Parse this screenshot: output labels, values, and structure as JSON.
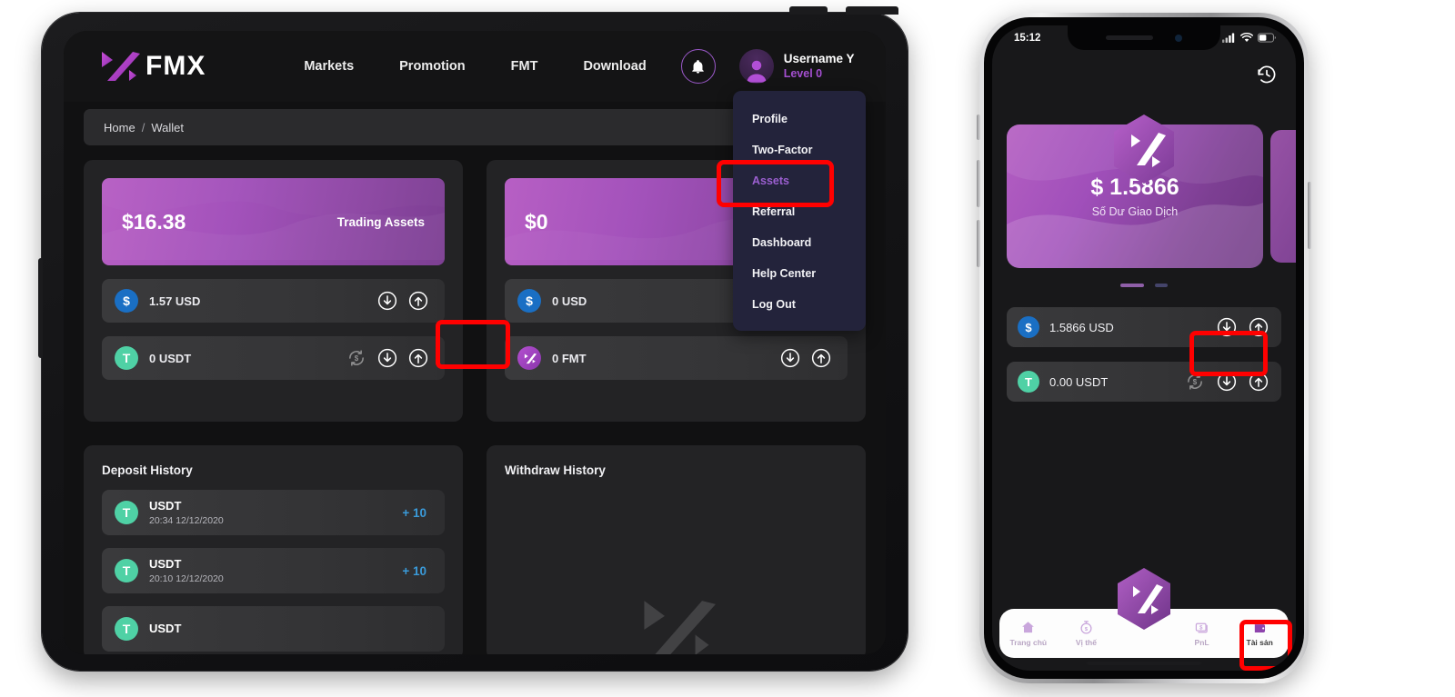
{
  "desktop": {
    "brand": "FMX",
    "nav": [
      {
        "label": "Markets"
      },
      {
        "label": "Promotion"
      },
      {
        "label": "FMT"
      },
      {
        "label": "Download"
      }
    ],
    "bell_icon": "bell-icon",
    "user": {
      "name": "Username Y",
      "level": "Level 0"
    },
    "dropdown": [
      {
        "label": "Profile",
        "active": false
      },
      {
        "label": "Two-Factor",
        "active": false
      },
      {
        "label": "Assets",
        "active": true
      },
      {
        "label": "Referral",
        "active": false
      },
      {
        "label": "Dashboard",
        "active": false
      },
      {
        "label": "Help Center",
        "active": false
      },
      {
        "label": "Log Out",
        "active": false
      }
    ],
    "breadcrumb": {
      "home": "Home",
      "separator": "/",
      "current": "Wallet"
    },
    "wallet_left": {
      "amount": "$16.38",
      "label": "Trading Assets",
      "assets": [
        {
          "symbol": "$",
          "name": "1.57 USD",
          "kind": "usd",
          "swap": false
        },
        {
          "symbol": "T",
          "name": "0 USDT",
          "kind": "usdt",
          "swap": true
        }
      ]
    },
    "wallet_right": {
      "amount": "$0",
      "label": "",
      "assets": [
        {
          "symbol": "$",
          "name": "0 USD",
          "kind": "usd",
          "swap": false
        },
        {
          "symbol": "Z",
          "name": "0 FMT",
          "kind": "fmt",
          "swap": false
        }
      ]
    },
    "deposit_history": {
      "title": "Deposit History",
      "rows": [
        {
          "symbol": "USDT",
          "time": "20:34 12/12/2020",
          "amount": "+ 10"
        },
        {
          "symbol": "USDT",
          "time": "20:10 12/12/2020",
          "amount": "+ 10"
        },
        {
          "symbol": "USDT",
          "time": "",
          "amount": ""
        }
      ]
    },
    "withdraw_history": {
      "title": "Withdraw History",
      "rows": []
    },
    "icons": {
      "deposit": "download-arrow-icon",
      "withdraw": "upload-arrow-icon",
      "swap": "swap-dollar-icon"
    }
  },
  "mobile": {
    "status": {
      "time": "15:12",
      "signal_icon": "cellular-signal-icon",
      "wifi_icon": "wifi-icon",
      "battery_icon": "battery-icon"
    },
    "history_icon": "clock-history-icon",
    "card": {
      "balance": "$ 1.5866",
      "label": "Số Dư Giao Dịch"
    },
    "assets": [
      {
        "symbol": "$",
        "name": "1.5866 USD",
        "kind": "usd",
        "swap": false
      },
      {
        "symbol": "T",
        "name": "0.00 USDT",
        "kind": "usdt",
        "swap": true
      }
    ],
    "bottom_nav": [
      {
        "label": "Trang chủ",
        "icon": "home-icon",
        "active": false
      },
      {
        "label": "Vị thế",
        "icon": "stopwatch-icon",
        "active": false
      },
      {
        "label": "PnL",
        "icon": "money-stack-icon",
        "active": false
      },
      {
        "label": "Tài sản",
        "icon": "wallet-icon",
        "active": true
      }
    ]
  },
  "colors": {
    "accent_purple": "#a44fd0",
    "highlight_red": "#ff0000",
    "usd_blue": "#1a6fc4",
    "usdt_green": "#4fd1a5",
    "amount_blue": "#3a9ad9"
  }
}
